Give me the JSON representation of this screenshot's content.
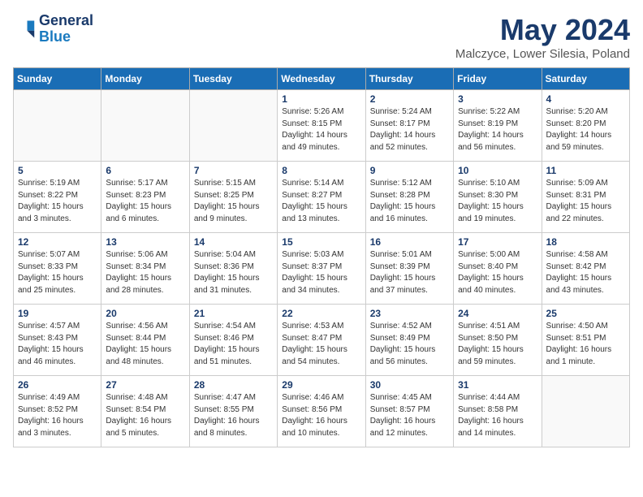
{
  "header": {
    "logo_line1": "General",
    "logo_line2": "Blue",
    "title": "May 2024",
    "subtitle": "Malczyce, Lower Silesia, Poland"
  },
  "weekdays": [
    "Sunday",
    "Monday",
    "Tuesday",
    "Wednesday",
    "Thursday",
    "Friday",
    "Saturday"
  ],
  "weeks": [
    [
      {
        "day": "",
        "info": ""
      },
      {
        "day": "",
        "info": ""
      },
      {
        "day": "",
        "info": ""
      },
      {
        "day": "1",
        "info": "Sunrise: 5:26 AM\nSunset: 8:15 PM\nDaylight: 14 hours\nand 49 minutes."
      },
      {
        "day": "2",
        "info": "Sunrise: 5:24 AM\nSunset: 8:17 PM\nDaylight: 14 hours\nand 52 minutes."
      },
      {
        "day": "3",
        "info": "Sunrise: 5:22 AM\nSunset: 8:19 PM\nDaylight: 14 hours\nand 56 minutes."
      },
      {
        "day": "4",
        "info": "Sunrise: 5:20 AM\nSunset: 8:20 PM\nDaylight: 14 hours\nand 59 minutes."
      }
    ],
    [
      {
        "day": "5",
        "info": "Sunrise: 5:19 AM\nSunset: 8:22 PM\nDaylight: 15 hours\nand 3 minutes."
      },
      {
        "day": "6",
        "info": "Sunrise: 5:17 AM\nSunset: 8:23 PM\nDaylight: 15 hours\nand 6 minutes."
      },
      {
        "day": "7",
        "info": "Sunrise: 5:15 AM\nSunset: 8:25 PM\nDaylight: 15 hours\nand 9 minutes."
      },
      {
        "day": "8",
        "info": "Sunrise: 5:14 AM\nSunset: 8:27 PM\nDaylight: 15 hours\nand 13 minutes."
      },
      {
        "day": "9",
        "info": "Sunrise: 5:12 AM\nSunset: 8:28 PM\nDaylight: 15 hours\nand 16 minutes."
      },
      {
        "day": "10",
        "info": "Sunrise: 5:10 AM\nSunset: 8:30 PM\nDaylight: 15 hours\nand 19 minutes."
      },
      {
        "day": "11",
        "info": "Sunrise: 5:09 AM\nSunset: 8:31 PM\nDaylight: 15 hours\nand 22 minutes."
      }
    ],
    [
      {
        "day": "12",
        "info": "Sunrise: 5:07 AM\nSunset: 8:33 PM\nDaylight: 15 hours\nand 25 minutes."
      },
      {
        "day": "13",
        "info": "Sunrise: 5:06 AM\nSunset: 8:34 PM\nDaylight: 15 hours\nand 28 minutes."
      },
      {
        "day": "14",
        "info": "Sunrise: 5:04 AM\nSunset: 8:36 PM\nDaylight: 15 hours\nand 31 minutes."
      },
      {
        "day": "15",
        "info": "Sunrise: 5:03 AM\nSunset: 8:37 PM\nDaylight: 15 hours\nand 34 minutes."
      },
      {
        "day": "16",
        "info": "Sunrise: 5:01 AM\nSunset: 8:39 PM\nDaylight: 15 hours\nand 37 minutes."
      },
      {
        "day": "17",
        "info": "Sunrise: 5:00 AM\nSunset: 8:40 PM\nDaylight: 15 hours\nand 40 minutes."
      },
      {
        "day": "18",
        "info": "Sunrise: 4:58 AM\nSunset: 8:42 PM\nDaylight: 15 hours\nand 43 minutes."
      }
    ],
    [
      {
        "day": "19",
        "info": "Sunrise: 4:57 AM\nSunset: 8:43 PM\nDaylight: 15 hours\nand 46 minutes."
      },
      {
        "day": "20",
        "info": "Sunrise: 4:56 AM\nSunset: 8:44 PM\nDaylight: 15 hours\nand 48 minutes."
      },
      {
        "day": "21",
        "info": "Sunrise: 4:54 AM\nSunset: 8:46 PM\nDaylight: 15 hours\nand 51 minutes."
      },
      {
        "day": "22",
        "info": "Sunrise: 4:53 AM\nSunset: 8:47 PM\nDaylight: 15 hours\nand 54 minutes."
      },
      {
        "day": "23",
        "info": "Sunrise: 4:52 AM\nSunset: 8:49 PM\nDaylight: 15 hours\nand 56 minutes."
      },
      {
        "day": "24",
        "info": "Sunrise: 4:51 AM\nSunset: 8:50 PM\nDaylight: 15 hours\nand 59 minutes."
      },
      {
        "day": "25",
        "info": "Sunrise: 4:50 AM\nSunset: 8:51 PM\nDaylight: 16 hours\nand 1 minute."
      }
    ],
    [
      {
        "day": "26",
        "info": "Sunrise: 4:49 AM\nSunset: 8:52 PM\nDaylight: 16 hours\nand 3 minutes."
      },
      {
        "day": "27",
        "info": "Sunrise: 4:48 AM\nSunset: 8:54 PM\nDaylight: 16 hours\nand 5 minutes."
      },
      {
        "day": "28",
        "info": "Sunrise: 4:47 AM\nSunset: 8:55 PM\nDaylight: 16 hours\nand 8 minutes."
      },
      {
        "day": "29",
        "info": "Sunrise: 4:46 AM\nSunset: 8:56 PM\nDaylight: 16 hours\nand 10 minutes."
      },
      {
        "day": "30",
        "info": "Sunrise: 4:45 AM\nSunset: 8:57 PM\nDaylight: 16 hours\nand 12 minutes."
      },
      {
        "day": "31",
        "info": "Sunrise: 4:44 AM\nSunset: 8:58 PM\nDaylight: 16 hours\nand 14 minutes."
      },
      {
        "day": "",
        "info": ""
      }
    ]
  ]
}
